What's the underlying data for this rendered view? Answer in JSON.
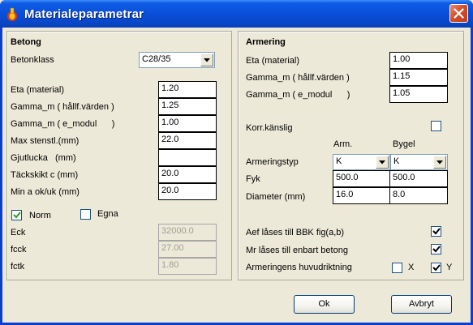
{
  "window": {
    "title": "Materialeparametrar"
  },
  "betong": {
    "heading": "Betong",
    "betongklass_label": "Betonklass",
    "betongklass_value": "C28/35",
    "fields": [
      {
        "label": "Eta (material)",
        "value": "1.20"
      },
      {
        "label": "Gamma_m ( hållf.värden )",
        "value": "1.25"
      },
      {
        "label": "Gamma_m ( e_modul      )",
        "value": "1.00"
      },
      {
        "label": "Max stenstl.(mm)",
        "value": "22.0"
      },
      {
        "label": "Gjutlucka   (mm)",
        "value": ""
      },
      {
        "label": "Täckskikt c (mm)",
        "value": "20.0"
      },
      {
        "label": "Min a ok/uk (mm)",
        "value": "20.0"
      }
    ],
    "norm_label": "Norm",
    "norm_checked": true,
    "egna_label": "Egna",
    "egna_checked": false,
    "derived": [
      {
        "label": "Eck",
        "value": "32000.0"
      },
      {
        "label": "fcck",
        "value": "27.00"
      },
      {
        "label": "fctk",
        "value": "1.80"
      }
    ]
  },
  "armering": {
    "heading": "Armering",
    "fields": [
      {
        "label": "Eta (material)",
        "value": "1.00"
      },
      {
        "label": "Gamma_m ( hållf.värden )",
        "value": "1.15"
      },
      {
        "label": "Gamma_m ( e_modul      )",
        "value": "1.05"
      }
    ],
    "korr_label": "Korr.känslig",
    "korr_checked": false,
    "col_arm": "Arm.",
    "col_bygel": "Bygel",
    "typ_label": "Armeringstyp",
    "typ_arm": "K",
    "typ_bygel": "K",
    "fyk_label": "Fyk",
    "fyk_arm": "500.0",
    "fyk_bygel": "500.0",
    "diam_label": "Diameter (mm)",
    "diam_arm": "16.0",
    "diam_bygel": "8.0",
    "aef_label": "Aef låses till BBK fig(a,b)",
    "aef_checked": true,
    "mr_label": "Mr låses till enbart betong",
    "mr_checked": true,
    "huvud_label": "Armeringens huvudriktning",
    "x_label": "X",
    "x_checked": false,
    "y_label": "Y",
    "y_checked": true
  },
  "buttons": {
    "ok": "Ok",
    "cancel": "Avbryt"
  }
}
